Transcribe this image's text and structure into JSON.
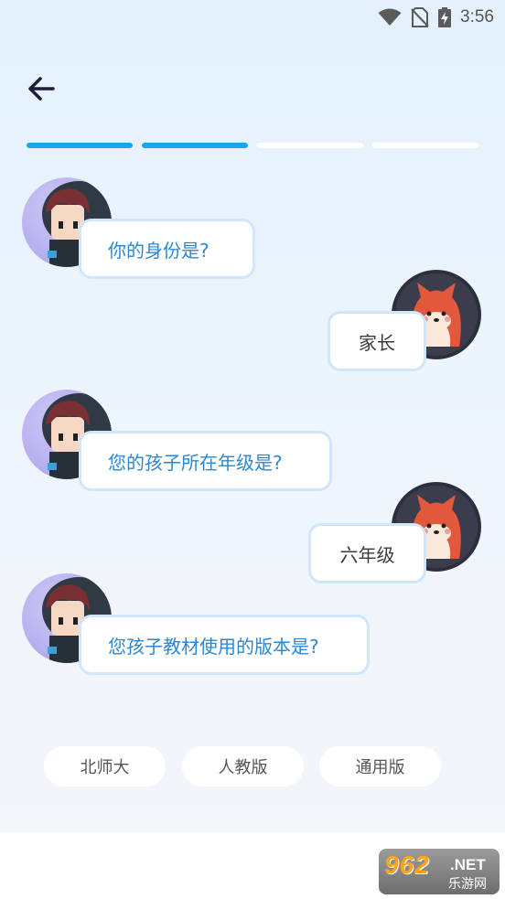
{
  "status_bar": {
    "time": "3:56",
    "icons": [
      "wifi-icon",
      "no-sim-icon",
      "battery-charging-icon"
    ]
  },
  "header": {
    "back_icon": "arrow-left-icon"
  },
  "progress": {
    "total_steps": 4,
    "completed_steps": 2,
    "active_color": "#1aa6ea",
    "inactive_color": "#ffffff"
  },
  "chat": {
    "q1": "你的身份是?",
    "a1": "家长",
    "q2": "您的孩子所在年级是?",
    "a2": "六年级",
    "q3": "您孩子教材使用的版本是?"
  },
  "options": [
    "北师大",
    "人教版",
    "通用版"
  ],
  "watermark": {
    "number": "962",
    "net": ".NET",
    "cn": "乐游网"
  },
  "colors": {
    "question_text": "#2b87d6",
    "bubble_border": "#cfe6fb"
  }
}
